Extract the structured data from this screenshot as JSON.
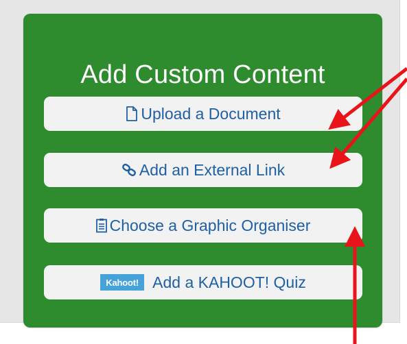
{
  "panel": {
    "title": "Add Custom Content",
    "accent_color": "#2e8b2e"
  },
  "buttons": [
    {
      "label": "Upload a Document",
      "icon": "document-icon"
    },
    {
      "label": "Add an External Link",
      "icon": "link-icon"
    },
    {
      "label": "Choose a Graphic Organiser",
      "icon": "organiser-icon"
    },
    {
      "label": "Add a KAHOOT! Quiz",
      "icon": "kahoot-logo",
      "logo_text": "Kahoot!"
    }
  ],
  "annotations": {
    "arrow_color": "#e8141a"
  }
}
